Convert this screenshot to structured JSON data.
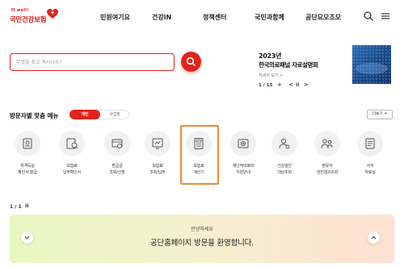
{
  "header": {
    "logo_small": "ft well!",
    "logo_text": "국민건강보험",
    "nav": [
      "민원여기요",
      "건강iN",
      "정책센터",
      "국민과함께",
      "공단요모조모"
    ],
    "icons": [
      "search-icon",
      "hamburger-menu-icon"
    ]
  },
  "search": {
    "placeholder": "무엇을 찾고 계시나요?",
    "button_icon": "search-icon"
  },
  "banner": {
    "year_title": "2023년",
    "title": "한국의료패널 자료설명회",
    "more": "자세히 보기 >",
    "page": "1 / 15",
    "controls": [
      "+",
      "<",
      "II",
      ">"
    ]
  },
  "menu": {
    "title": "방문자별 맞춤 메뉴",
    "tabs": [
      "개인",
      "사업장"
    ],
    "more_label": "더보기 +",
    "services": [
      {
        "label1": "자격득실",
        "label2": "확인서 발급",
        "icon": "certificate-icon"
      },
      {
        "label1": "보험료",
        "label2": "납부확인서",
        "icon": "payment-confirmation-icon"
      },
      {
        "label1": "환급금",
        "label2": "조회/신청",
        "icon": "refund-icon"
      },
      {
        "label1": "보험료",
        "label2": "조회/납부",
        "icon": "premium-inquiry-icon"
      },
      {
        "label1": "보험료",
        "label2": "계산기",
        "icon": "calculator-icon"
      },
      {
        "label1": "재난적의료비",
        "label2": "지원안내",
        "icon": "medical-support-icon"
      },
      {
        "label1": "건강검진",
        "label2": "대상조회",
        "icon": "health-checkup-icon"
      },
      {
        "label1": "영유아",
        "label2": "검진결과조회",
        "icon": "infant-checkup-icon"
      },
      {
        "label1": "서식",
        "label2": "자료실",
        "icon": "forms-library-icon"
      }
    ]
  },
  "slider": {
    "pager": "1 / 1",
    "pause": "II",
    "greeting": "안녕하세요",
    "message": "공단홈페이지 방문을 환영합니다."
  },
  "colors": {
    "brand_red": "#e2231a",
    "highlight_orange": "#f08a30"
  }
}
